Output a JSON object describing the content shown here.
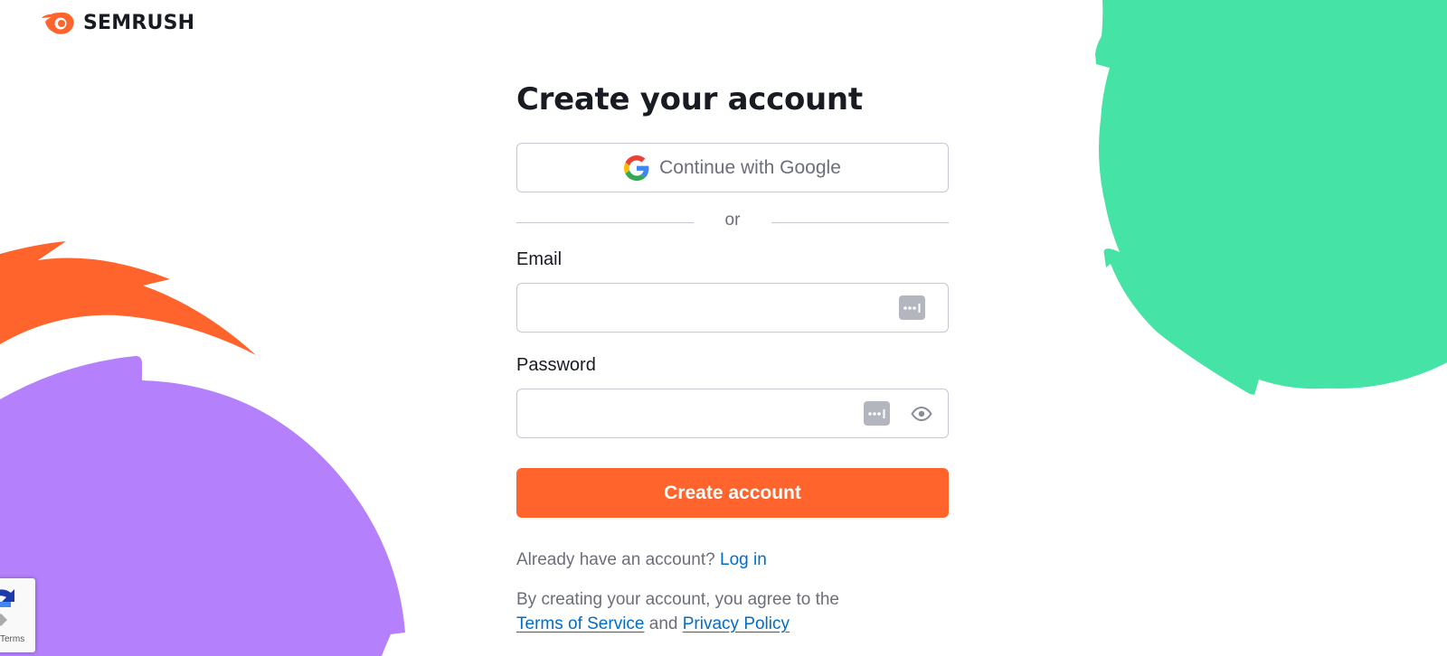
{
  "brand": {
    "name": "SEMRUSH",
    "accent_color": "#ff642d",
    "green_color": "#45e3a6",
    "purple_color": "#b480fc"
  },
  "form": {
    "title": "Create your account",
    "google_button_label": "Continue with Google",
    "divider_text": "or",
    "email_label": "Email",
    "email_value": "",
    "password_label": "Password",
    "password_value": "",
    "submit_label": "Create account"
  },
  "login": {
    "prompt": "Already have an account?",
    "link_label": "Log in"
  },
  "legal": {
    "text": "By creating your account, you agree to the",
    "terms_label": "Terms of Service",
    "and_text": "and",
    "privacy_label": "Privacy Policy"
  },
  "recaptcha": {
    "terms_label": "Terms"
  },
  "icons": {
    "logo": "semrush-fireball-icon",
    "google": "google-g-icon",
    "password_manager": "password-manager-icon",
    "show_password": "eye-icon"
  }
}
